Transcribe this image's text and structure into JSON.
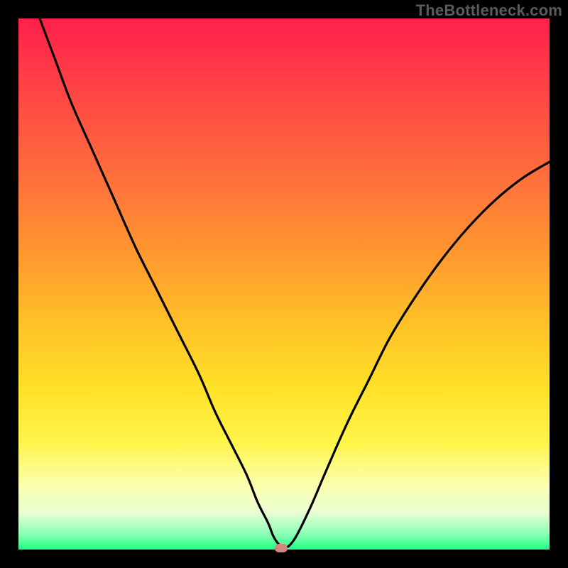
{
  "watermark": "TheBottleneck.com",
  "chart_data": {
    "type": "line",
    "title": "",
    "xlabel": "",
    "ylabel": "",
    "xlim": [
      0,
      100
    ],
    "ylim": [
      0,
      100
    ],
    "series": [
      {
        "name": "curve",
        "x": [
          4,
          7,
          10,
          14,
          18,
          22,
          26,
          30,
          34,
          37,
          40,
          43,
          45,
          47,
          48,
          49,
          50,
          52,
          55,
          58,
          62,
          66,
          70,
          75,
          80,
          85,
          90,
          95,
          100
        ],
        "y": [
          100,
          92,
          84,
          75,
          66,
          57,
          49,
          41,
          33,
          26,
          20,
          14,
          9,
          5,
          2.5,
          1,
          0.2,
          2,
          8,
          15,
          24,
          32,
          40,
          48,
          55,
          61,
          66,
          70,
          73
        ]
      }
    ],
    "marker": {
      "x": 49.5,
      "y": 0.3
    },
    "gradient_stops": [
      {
        "pos": 0,
        "color": "#ff1f4a"
      },
      {
        "pos": 10,
        "color": "#ff3b47"
      },
      {
        "pos": 28,
        "color": "#ff6a3d"
      },
      {
        "pos": 45,
        "color": "#ff9a2e"
      },
      {
        "pos": 58,
        "color": "#ffc327"
      },
      {
        "pos": 70,
        "color": "#ffe228"
      },
      {
        "pos": 80,
        "color": "#fff54a"
      },
      {
        "pos": 88,
        "color": "#fcffb0"
      },
      {
        "pos": 93,
        "color": "#e9ffd2"
      },
      {
        "pos": 97,
        "color": "#8fffb8"
      },
      {
        "pos": 100,
        "color": "#1fff82"
      }
    ]
  }
}
